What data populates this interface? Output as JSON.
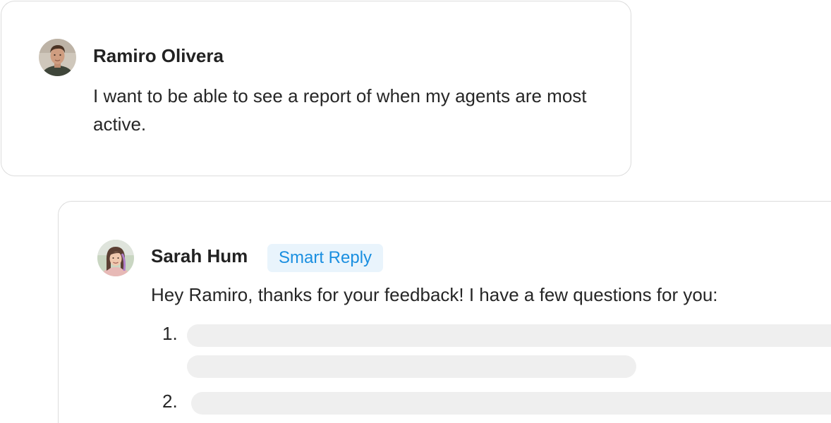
{
  "original_message": {
    "author": "Ramiro Olivera",
    "text": "I want to be able to see a report of when my agents are most active."
  },
  "reply": {
    "author": "Sarah Hum",
    "badge": "Smart Reply",
    "text": "Hey Ramiro, thanks for your feedback! I have a few questions for you:",
    "list_markers": [
      "1.",
      "2."
    ]
  },
  "colors": {
    "badge_bg": "#e9f4fc",
    "badge_text": "#1a8fe0",
    "placeholder": "#efefef",
    "card_border": "#dcdcdc"
  }
}
